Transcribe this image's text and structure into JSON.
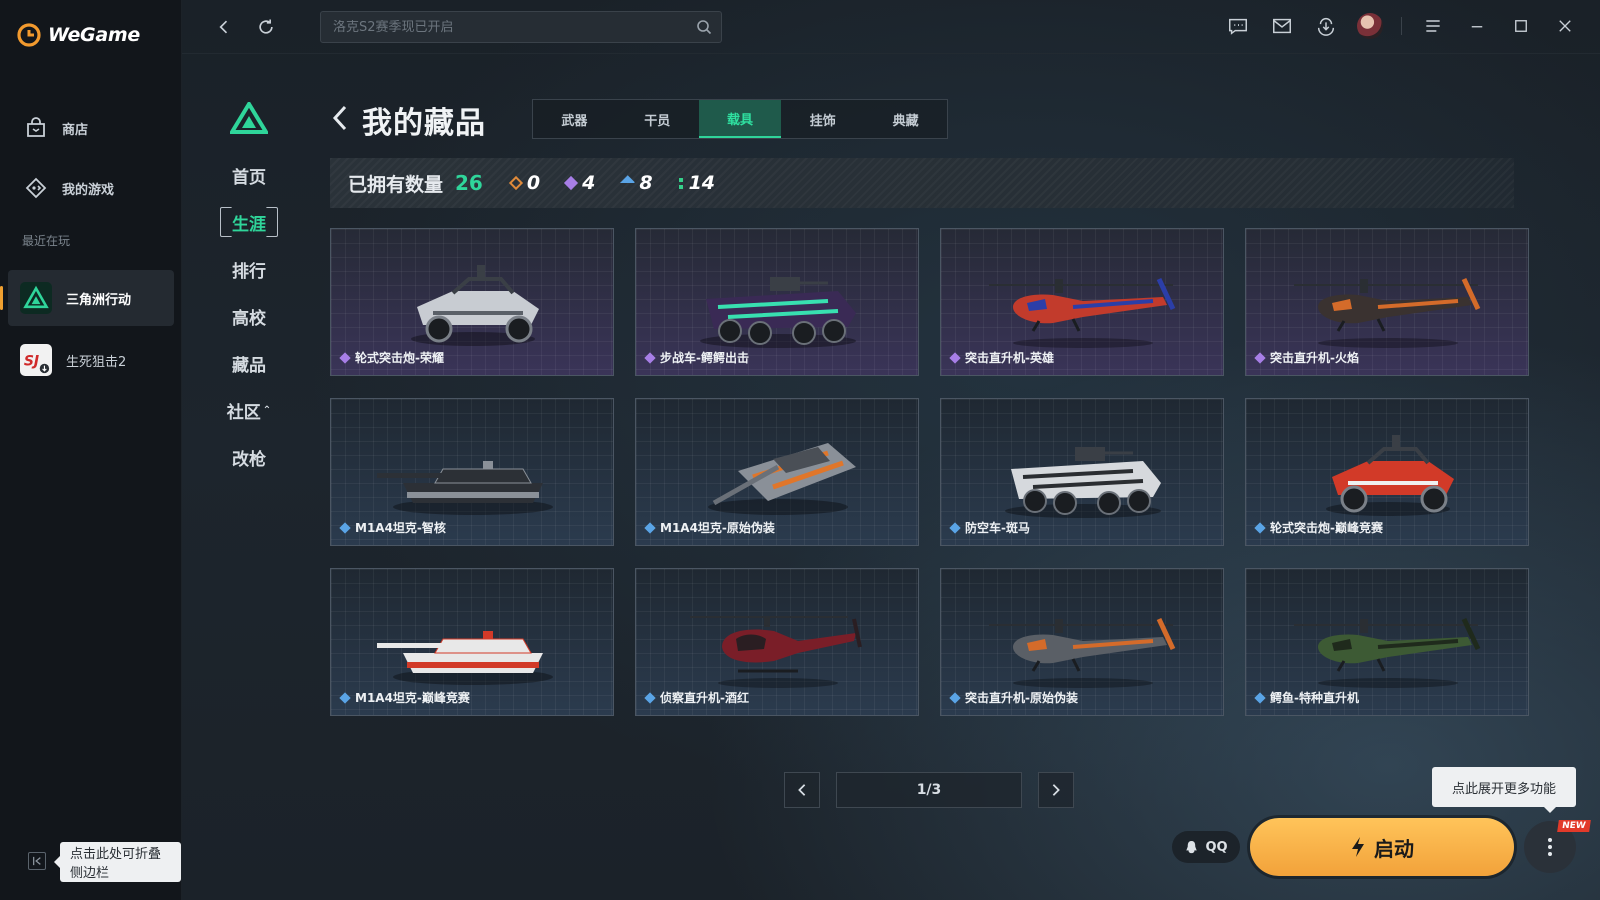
{
  "app": {
    "logo_text": "WeGame"
  },
  "sidebar": {
    "items": [
      {
        "label": "商店",
        "icon": "shop-bag-icon"
      },
      {
        "label": "我的游戏",
        "icon": "gamepad-icon"
      }
    ],
    "recent_label": "最近在玩",
    "recent": [
      {
        "label": "三角洲行动",
        "active": true
      },
      {
        "label": "生死狙击2",
        "active": false
      }
    ],
    "collapse_tip": "点击此处可折叠侧边栏"
  },
  "topbar": {
    "search_placeholder": "洛克S2赛季现已开启",
    "icons": [
      "chat-icon",
      "mail-icon",
      "download-icon",
      "avatar",
      "menu-icon",
      "minimize-icon",
      "maximize-icon",
      "close-icon"
    ]
  },
  "game_nav": {
    "items": [
      "首页",
      "生涯",
      "排行",
      "高校",
      "藏品",
      "社区",
      "改枪"
    ],
    "active": "生涯"
  },
  "page": {
    "title": "我的藏品",
    "tabs": [
      "武器",
      "干员",
      "载具",
      "挂饰",
      "典藏"
    ],
    "active_tab": "载具"
  },
  "stats": {
    "label": "已拥有数量",
    "total": "26",
    "ranks": [
      {
        "value": "0",
        "color": "#e08a3a"
      },
      {
        "value": "4",
        "color": "#a77ee6"
      },
      {
        "value": "8",
        "color": "#5aa4e6"
      },
      {
        "value": "14",
        "color": "#35d08a"
      }
    ]
  },
  "cards": [
    {
      "name": "轮式突击炮-荣耀",
      "rarity": "purple",
      "type": "buggy",
      "colors": [
        "#c8ccd2",
        "#5a6068"
      ]
    },
    {
      "name": "步战车-鳄鳄出击",
      "rarity": "purple",
      "type": "apc",
      "colors": [
        "#3a2a55",
        "#38e0b0"
      ]
    },
    {
      "name": "突击直升机-英雄",
      "rarity": "purple",
      "type": "heli",
      "colors": [
        "#c23b2c",
        "#2b3ea8"
      ]
    },
    {
      "name": "突击直升机-火焰",
      "rarity": "purple",
      "type": "heli",
      "colors": [
        "#3a3230",
        "#d46b2a"
      ]
    },
    {
      "name": "M1A4坦克-智核",
      "rarity": "blue",
      "type": "tank",
      "colors": [
        "#2c3036",
        "#8a9098"
      ]
    },
    {
      "name": "M1A4坦克-原始伪装",
      "rarity": "blue",
      "type": "tank-angled",
      "colors": [
        "#8a9098",
        "#e0762a"
      ]
    },
    {
      "name": "防空车-斑马",
      "rarity": "blue",
      "type": "apc",
      "colors": [
        "#d6d9dd",
        "#2a2d31"
      ]
    },
    {
      "name": "轮式突击炮-巅峰竞赛",
      "rarity": "blue",
      "type": "buggy",
      "colors": [
        "#d23a28",
        "#f0f0f0"
      ]
    },
    {
      "name": "M1A4坦克-巅峰竞赛",
      "rarity": "blue",
      "type": "tank",
      "colors": [
        "#e8e8e8",
        "#d23a28"
      ]
    },
    {
      "name": "侦察直升机-酒红",
      "rarity": "blue",
      "type": "heli-small",
      "colors": [
        "#7a1e28",
        "#2a1e22"
      ]
    },
    {
      "name": "突击直升机-原始伪装",
      "rarity": "blue",
      "type": "heli",
      "colors": [
        "#5a5f66",
        "#d46b2a"
      ]
    },
    {
      "name": "鳄鱼-特种直升机",
      "rarity": "blue",
      "type": "heli",
      "colors": [
        "#3d5a34",
        "#1f2a1c"
      ]
    }
  ],
  "pager": {
    "text": "1/3"
  },
  "bottom": {
    "more_tip": "点此展开更多功能",
    "qq_label": "QQ",
    "launch_label": "启动",
    "new_badge": "NEW"
  }
}
